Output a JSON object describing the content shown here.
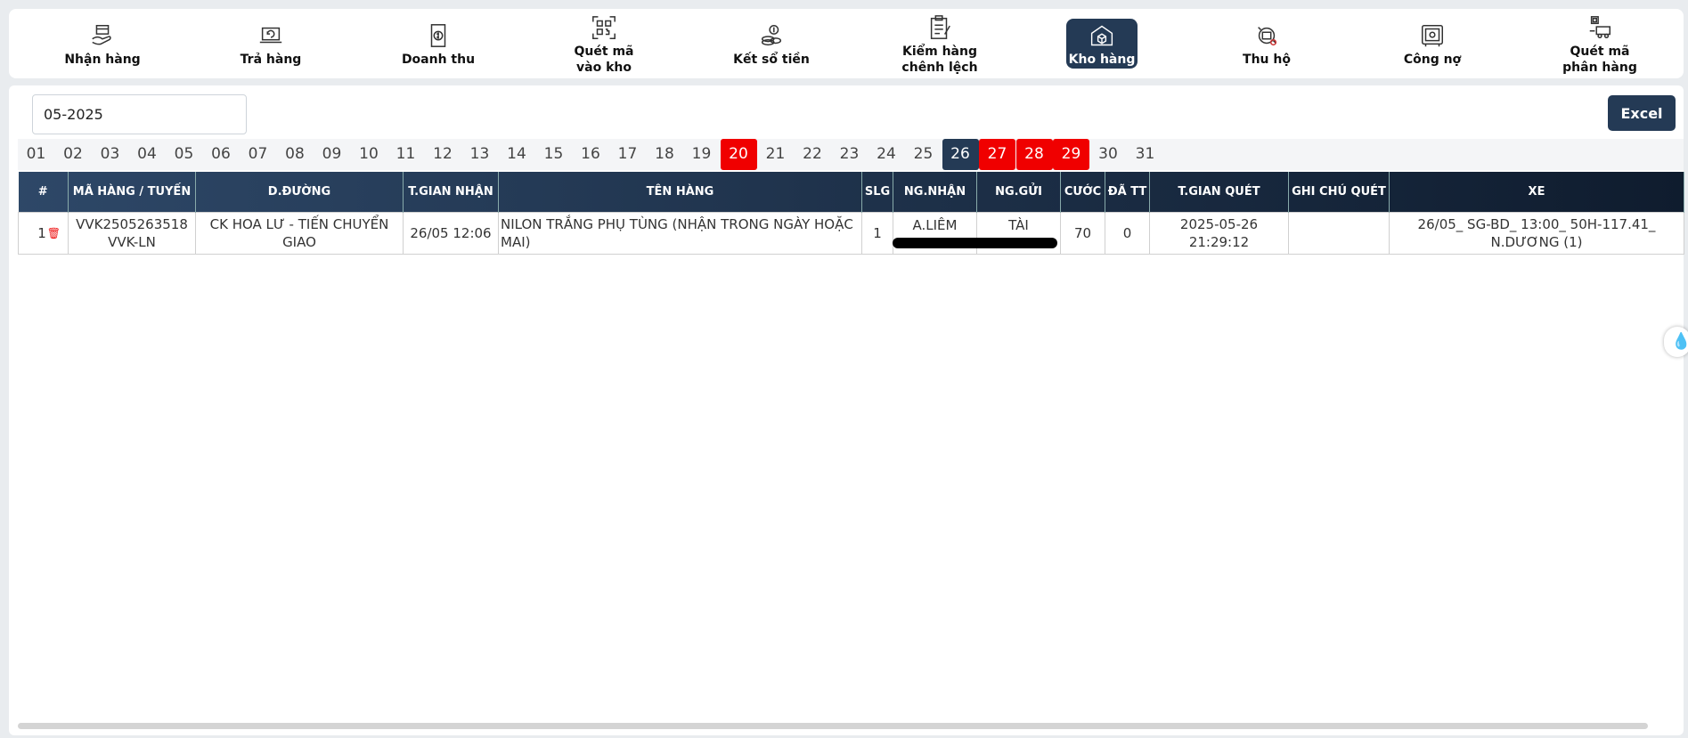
{
  "nav": [
    {
      "label": "Nhận hàng",
      "icon": "receive-package-icon"
    },
    {
      "label": "Trả hàng",
      "icon": "return-laptop-icon"
    },
    {
      "label": "Doanh thu",
      "icon": "revenue-cash-icon"
    },
    {
      "label": "Quét mã\nvào kho",
      "icon": "qr-scan-icon"
    },
    {
      "label": "Kết sổ tiền",
      "icon": "coins-stack-icon"
    },
    {
      "label": "Kiểm hàng\nchênh lệch",
      "icon": "clipboard-check-icon"
    },
    {
      "label": "Kho hàng",
      "icon": "warehouse-icon",
      "active": true
    },
    {
      "label": "Thu hộ",
      "icon": "cod-collect-icon"
    },
    {
      "label": "Công nợ",
      "icon": "safe-box-icon"
    },
    {
      "label": "Quét mã\nphân hàng",
      "icon": "scan-sort-icon"
    }
  ],
  "filter": {
    "month_value": "05-2025"
  },
  "excel_label": "Excel",
  "days": [
    "01",
    "02",
    "03",
    "04",
    "05",
    "06",
    "07",
    "08",
    "09",
    "10",
    "11",
    "12",
    "13",
    "14",
    "15",
    "16",
    "17",
    "18",
    "19",
    "20",
    "21",
    "22",
    "23",
    "24",
    "25",
    "26",
    "27",
    "28",
    "29",
    "30",
    "31"
  ],
  "red_days": [
    "20",
    "27",
    "28",
    "29"
  ],
  "selected_day": "26",
  "colors": {
    "accent": "#243a55",
    "alert_red": "#f00000"
  },
  "table": {
    "headers": [
      "#",
      "MÃ HÀNG / TUYẾN",
      "D.ĐƯỜNG",
      "T.GIAN NHẬN",
      "TÊN HÀNG",
      "SLG",
      "NG.NHẬN",
      "NG.GỬI",
      "CƯỚC",
      "ĐÃ TT",
      "T.GIAN QUÉT",
      "GHI CHÚ QUÉT",
      "XE"
    ],
    "rows": [
      {
        "index": "1",
        "code": "VVK2505263518",
        "route": "VVK-LN",
        "road": "CK HOA LƯ - TIẾN CHUYỂN GIAO",
        "received_time": "26/05 12:06",
        "item_name": "NILON TRẮNG PHỤ TÙNG (NHẬN TRONG NGÀY HOẶC MAI)",
        "qty": "1",
        "receiver": "A.LIÊM",
        "sender": "TÀI",
        "fee": "70",
        "paid": "0",
        "scan_date": "2025-05-26",
        "scan_time": "21:29:12",
        "scan_note": "",
        "vehicle": "26/05_ SG-BD_ 13:00_ 50H-117.41_ N.DƯƠNG (1)"
      }
    ]
  }
}
